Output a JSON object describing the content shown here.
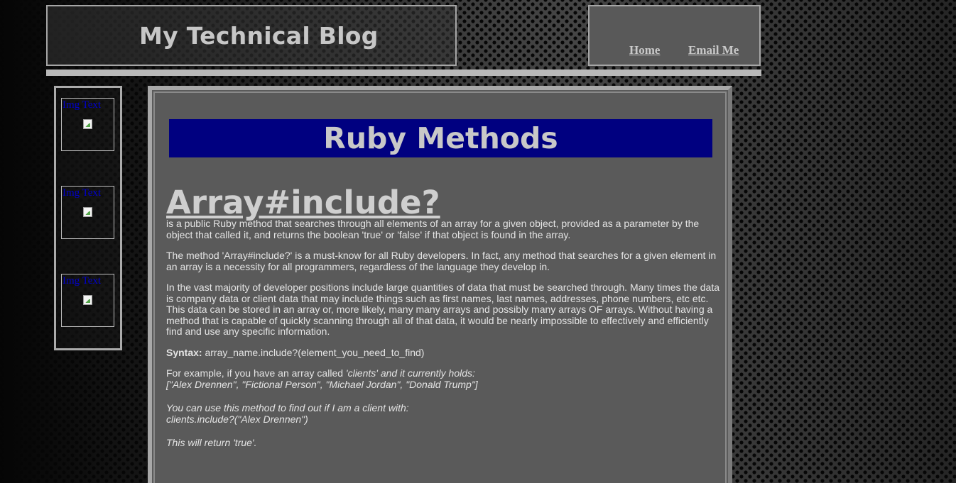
{
  "header": {
    "title": "My Technical Blog"
  },
  "nav": {
    "home": "Home",
    "email": "Email Me"
  },
  "sidebar": {
    "images": [
      {
        "alt": "Img Text"
      },
      {
        "alt": "Img Text"
      },
      {
        "alt": "Img Text"
      }
    ]
  },
  "main": {
    "section_title": "Ruby Methods",
    "article": {
      "title": "Array#include?",
      "intro": "is a public Ruby method that searches through all elements of an array for a given object, provided as a parameter by the object that called it, and returns the boolean 'true' or 'false' if that object is found in the array.",
      "para1": "The method 'Array#include?' is a must-know for all Ruby developers. In fact, any method that searches for a given element in an array is a necessity for all programmers, regardless of the language they develop in.",
      "para2": "In the vast majority of developer positions include large quantities of data that must be searched through. Many times the data is company data or client data that may include things such as first names, last names, addresses, phone numbers, etc etc. This data can be stored in an array or, more likely, many many arrays and possibly many arrays OF arrays. Without having a method that is capable of quickly scanning through all of that data, it would be nearly impossible to effectively and efficiently find and use any specific information.",
      "syntax_label": "Syntax:",
      "syntax_code": " array_name.include?(element_you_need_to_find)",
      "example_prefix": "For example, if you have an array called ",
      "example_italic": "'clients' and it currently holds:",
      "example_array": "[\"Alex Drennen\", \"Fictional Person\", \"Michael Jordan\", \"Donald Trump\"]",
      "usage_line1": "You can use this method to find out if I am a client with:",
      "usage_line2": "clients.include?(\"Alex Drennen\")",
      "result": "This will return 'true'."
    }
  }
}
